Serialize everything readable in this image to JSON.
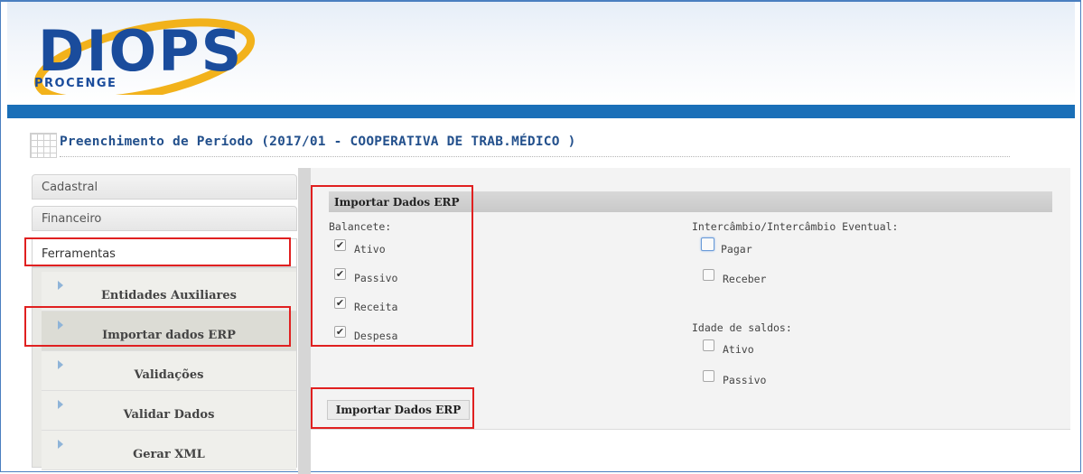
{
  "logo": {
    "main_text": "DIOPS",
    "sub_text": "PROCENGE"
  },
  "colors": {
    "header_bar": "#1a6fb8",
    "title_text": "#23508c",
    "highlight": "#e02020"
  },
  "page": {
    "title": "Preenchimento de Período (2017/01 - COOPERATIVA DE TRAB.MÉDICO )"
  },
  "sidebar": {
    "tabs": [
      {
        "label": "Cadastral"
      },
      {
        "label": "Financeiro"
      },
      {
        "label": "Ferramentas"
      }
    ],
    "submenu": [
      {
        "label": "Entidades Auxiliares"
      },
      {
        "label": "Importar dados ERP",
        "active": true
      },
      {
        "label": "Validações"
      },
      {
        "label": "Validar Dados"
      },
      {
        "label": "Gerar XML"
      }
    ]
  },
  "main": {
    "section_title": "Importar Dados ERP",
    "balancete": {
      "label": "Balancete:",
      "items": [
        {
          "label": "Ativo",
          "checked": true
        },
        {
          "label": "Passivo",
          "checked": true
        },
        {
          "label": "Receita",
          "checked": true
        },
        {
          "label": "Despesa",
          "checked": true
        }
      ]
    },
    "intercambio": {
      "label": "Intercâmbio/Intercâmbio Eventual:",
      "items": [
        {
          "label": "Pagar",
          "checked": false
        },
        {
          "label": "Receber",
          "checked": false
        }
      ]
    },
    "idade_saldos": {
      "label": "Idade de saldos:",
      "items": [
        {
          "label": "Ativo",
          "checked": false
        },
        {
          "label": "Passivo",
          "checked": false
        }
      ]
    },
    "import_button_label": "Importar Dados ERP"
  }
}
